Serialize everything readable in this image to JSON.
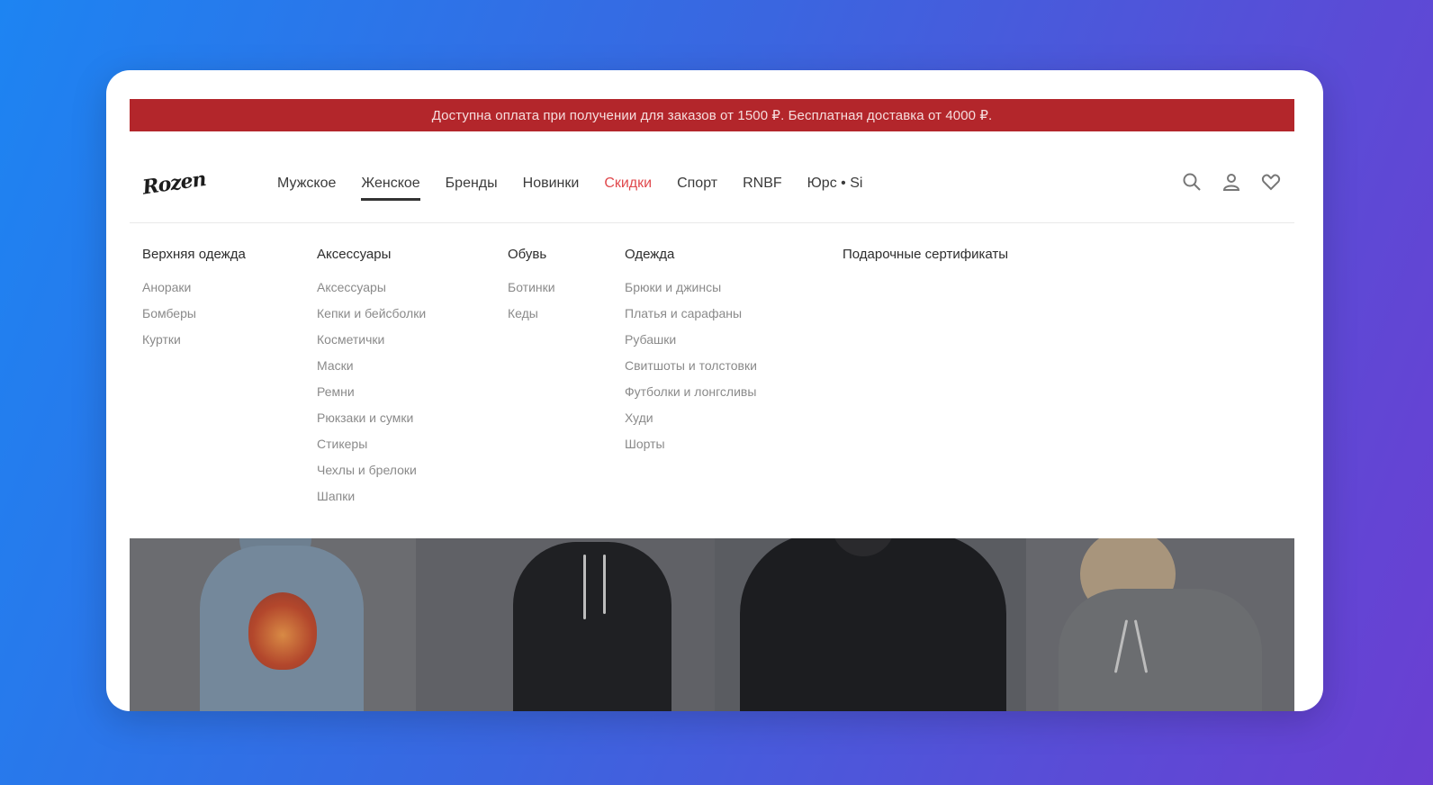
{
  "promo": {
    "text": "Доступна оплата при получении для заказов от 1500 ₽. Бесплатная доставка от 4000 ₽."
  },
  "header": {
    "logo_text": "Rozen",
    "nav": [
      {
        "label": "Мужское",
        "state": "normal"
      },
      {
        "label": "Женское",
        "state": "active"
      },
      {
        "label": "Бренды",
        "state": "normal"
      },
      {
        "label": "Новинки",
        "state": "normal"
      },
      {
        "label": "Скидки",
        "state": "sale"
      },
      {
        "label": "Спорт",
        "state": "normal"
      },
      {
        "label": "RNBF",
        "state": "normal"
      },
      {
        "label": "Юрс • Si",
        "state": "normal"
      }
    ],
    "icons": [
      "search-icon",
      "user-icon",
      "heart-icon"
    ]
  },
  "menu": {
    "columns": [
      {
        "title": "Верхняя одежда",
        "items": [
          "Анораки",
          "Бомберы",
          "Куртки"
        ]
      },
      {
        "title": "Аксессуары",
        "items": [
          "Аксессуары",
          "Кепки и бейсболки",
          "Косметички",
          "Маски",
          "Ремни",
          "Рюкзаки и сумки",
          "Стикеры",
          "Чехлы и брелоки",
          "Шапки"
        ]
      },
      {
        "title": "Обувь",
        "items": [
          "Ботинки",
          "Кеды"
        ]
      },
      {
        "title": "Одежда",
        "items": [
          "Брюки и джинсы",
          "Платья и сарафаны",
          "Рубашки",
          "Свитшоты и толстовки",
          "Футболки и лонгсливы",
          "Худи",
          "Шорты"
        ]
      },
      {
        "title": "Подарочные сертификаты",
        "items": []
      }
    ]
  },
  "colors": {
    "promo_bg": "#b3262b",
    "sale": "#e0494d",
    "background_start": "#1d84f2",
    "background_end": "#6a3fd2"
  }
}
